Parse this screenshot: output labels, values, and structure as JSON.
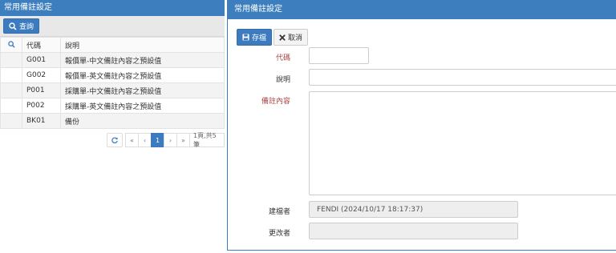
{
  "left": {
    "title": "常用備註設定",
    "query_button": "查詢",
    "columns": [
      "代碼",
      "說明"
    ],
    "rows": [
      {
        "code": "G001",
        "desc": "報價單-中文備註內容之預設值"
      },
      {
        "code": "G002",
        "desc": "報價單-英文備註內容之預設值"
      },
      {
        "code": "P001",
        "desc": "採購單-中文備註內容之預設值"
      },
      {
        "code": "P002",
        "desc": "採購單-英文備註內容之預設值"
      },
      {
        "code": "BK01",
        "desc": "備份"
      }
    ],
    "pager": {
      "first": "«",
      "prev": "‹",
      "current": "1",
      "next": "›",
      "last": "»",
      "info": "1頁,共5筆"
    }
  },
  "right": {
    "title": "常用備註設定",
    "save_button": "存檔",
    "cancel_button": "取消",
    "labels": {
      "code": "代碼",
      "desc": "說明",
      "content": "備註內容",
      "creator": "建檔者",
      "modifier": "更改者"
    },
    "values": {
      "code": "",
      "desc": "",
      "content": "",
      "creator": "FENDI (2024/10/17 18:17:37)",
      "modifier": ""
    }
  },
  "colors": {
    "header_blue": "#3d7ebe",
    "required_label": "#a94442"
  }
}
